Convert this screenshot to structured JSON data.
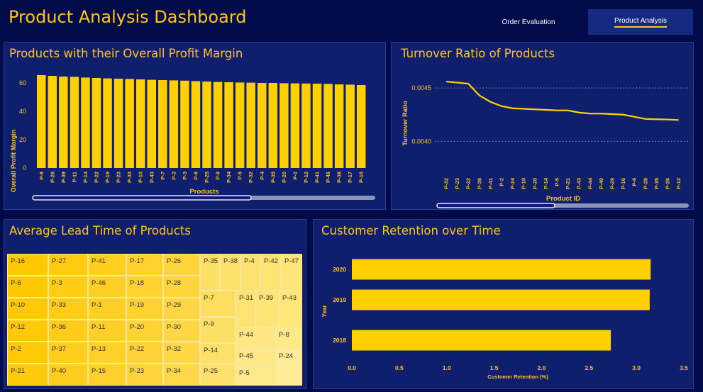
{
  "header": {
    "title": "Product Analysis Dashboard",
    "nav": [
      "Order Evaluation",
      "Product Analysis"
    ],
    "active": "Product Analysis"
  },
  "colors": {
    "bg": "#020b4a",
    "panel": "#0f1f6e",
    "accent": "#ffc61a",
    "bar": "#ffd000"
  },
  "margin": {
    "title": "Products with their Overall Profit Margin",
    "chart_data": {
      "type": "bar",
      "categories": [
        "P-8",
        "P-26",
        "P-39",
        "P-11",
        "P-14",
        "P-22",
        "P-19",
        "P-23",
        "P-33",
        "P-10",
        "P-43",
        "P-7",
        "P-2",
        "P-3",
        "P-6",
        "P-25",
        "P-9",
        "P-34",
        "P-5",
        "P-32",
        "P-4",
        "P-35",
        "P-20",
        "P-1",
        "P-12",
        "P-41",
        "P-46",
        "P-38",
        "P-17",
        "P-16"
      ],
      "values": [
        65.5,
        65,
        64.5,
        64.3,
        63.8,
        63.5,
        63.2,
        63,
        62.8,
        62.5,
        62.2,
        62,
        61.8,
        61.6,
        61.3,
        61,
        60.7,
        60.5,
        60.3,
        60.2,
        60,
        60,
        59.8,
        59.7,
        59.6,
        59.5,
        59.3,
        59,
        58.8,
        58.5
      ],
      "xlabel": "Products",
      "ylabel": "Overall Profit Margin",
      "yticks": [
        "0",
        "20",
        "40",
        "60"
      ],
      "ylim": [
        0,
        70
      ]
    }
  },
  "turnover": {
    "title": "Turnover Ratio of Products",
    "chart_data": {
      "type": "line",
      "categories": [
        "P-32",
        "P-23",
        "P-22",
        "P-39",
        "P-41",
        "P-2",
        "P-24",
        "P-19",
        "P-20",
        "P-14",
        "P-5",
        "P-21",
        "P-43",
        "P-44",
        "P-40",
        "P-29",
        "P-16",
        "P-9",
        "P-28",
        "P-35",
        "P-26",
        "P-12"
      ],
      "values": [
        0.00456,
        0.00455,
        0.00454,
        0.00443,
        0.00437,
        0.00433,
        0.00431,
        0.004305,
        0.0043,
        0.004295,
        0.00429,
        0.00429,
        0.00427,
        0.00426,
        0.00426,
        0.004255,
        0.00425,
        0.00423,
        0.00421,
        0.004207,
        0.004205,
        0.0042
      ],
      "xlabel": "Product ID",
      "ylabel": "Turnover Ratio",
      "yticks": [
        "0.0040",
        "0.0045"
      ],
      "ylim": [
        0.00385,
        0.0047
      ],
      "grid": true
    }
  },
  "lead": {
    "title": "Average Lead Time of Products",
    "chart_data": {
      "type": "heatmap",
      "labels": [
        "P-16",
        "P-27",
        "P-41",
        "P-17",
        "P-26",
        "P-35",
        "P-38",
        "P-4",
        "P-42",
        "P-47",
        "P-6",
        "P-3",
        "P-46",
        "P-18",
        "P-28",
        "P-10",
        "P-33",
        "P-1",
        "P-19",
        "P-29",
        "P-7",
        "P-31",
        "P-39",
        "P-43",
        "P-12",
        "P-36",
        "P-11",
        "P-20",
        "P-30",
        "P-9",
        "P-44",
        "P-8",
        "P-2",
        "P-37",
        "P-13",
        "P-22",
        "P-32",
        "P-14",
        "P-45",
        "P-21",
        "P-40",
        "P-15",
        "P-23",
        "P-34",
        "P-25",
        "P-5",
        "P-24"
      ]
    }
  },
  "retention": {
    "title": "Customer Retention over Time",
    "chart_data": {
      "type": "bar",
      "orientation": "horizontal",
      "categories": [
        "2020",
        "2019",
        "2018"
      ],
      "values": [
        3.15,
        3.14,
        2.73
      ],
      "xlabel": "Customer Retention (%)",
      "ylabel": "Year",
      "xticks": [
        "0.0",
        "0.5",
        "1.0",
        "1.5",
        "2.0",
        "2.5",
        "3.0",
        "3.5"
      ],
      "xlim": [
        0,
        3.5
      ]
    }
  }
}
